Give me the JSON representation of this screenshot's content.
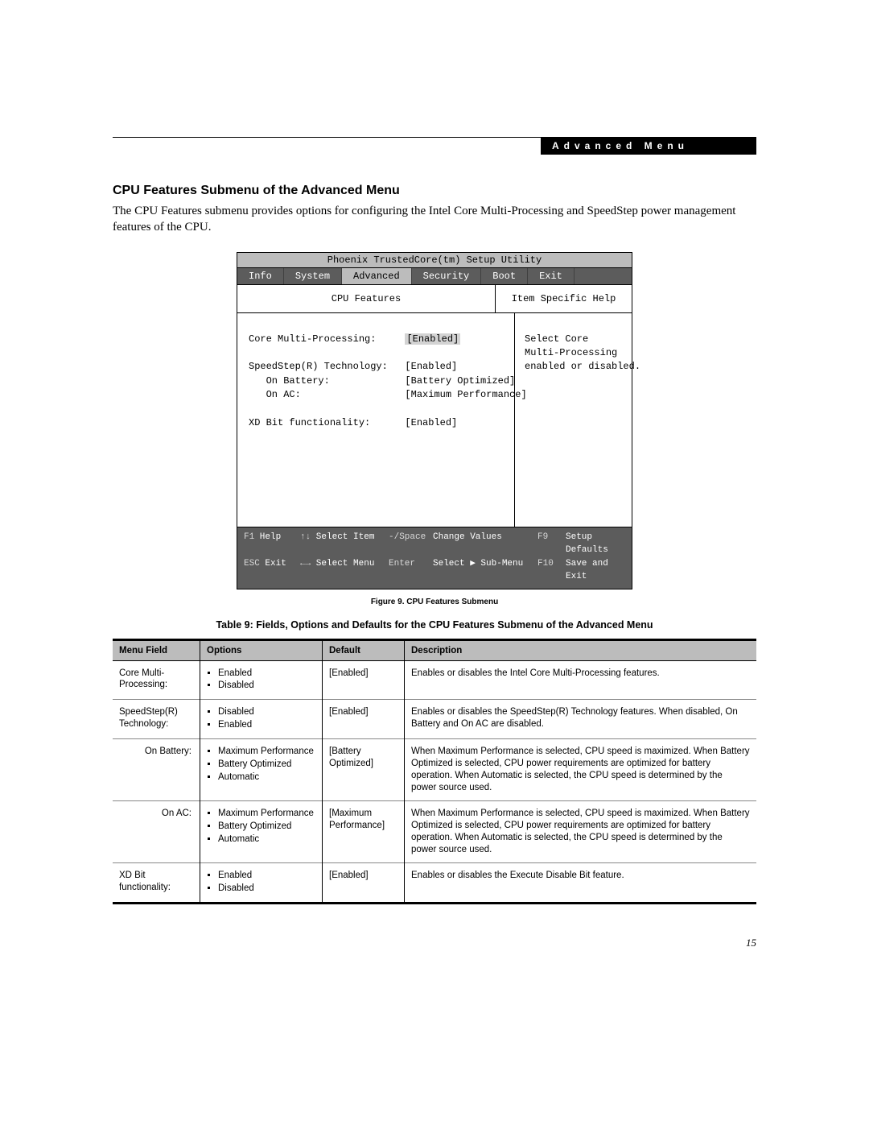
{
  "header": {
    "menuLabel": "Advanced Menu"
  },
  "section": {
    "title": "CPU Features Submenu of the Advanced Menu",
    "intro": "The CPU Features submenu provides options for configuring the Intel Core Multi-Processing and SpeedStep power management features of the CPU."
  },
  "bios": {
    "utilityTitle": "Phoenix TrustedCore(tm) Setup Utility",
    "tabs": [
      "Info",
      "System",
      "Advanced",
      "Security",
      "Boot",
      "Exit"
    ],
    "activeTab": "Advanced",
    "leftTitle": "CPU Features",
    "rightTitle": "Item Specific Help",
    "fields": [
      {
        "label": "Core Multi-Processing:",
        "value": "[Enabled]",
        "indent": 0,
        "selected": true
      },
      {
        "label": "",
        "value": "",
        "indent": 0
      },
      {
        "label": "SpeedStep(R) Technology:",
        "value": "[Enabled]",
        "indent": 0
      },
      {
        "label": "On Battery:",
        "value": "[Battery Optimized]",
        "indent": 1
      },
      {
        "label": "On AC:",
        "value": "[Maximum Performance]",
        "indent": 1
      },
      {
        "label": "",
        "value": "",
        "indent": 0
      },
      {
        "label": "XD Bit functionality:",
        "value": "[Enabled]",
        "indent": 0
      }
    ],
    "help": "Select Core\nMulti-Processing\nenabled or disabled.",
    "footer": [
      {
        "k1": "F1",
        "a1": "Help",
        "k2": "↑↓",
        "a2": "Select Item",
        "k3": "-/Space",
        "a3": "Change Values",
        "k4": "F9",
        "a4": "Setup Defaults"
      },
      {
        "k1": "ESC",
        "a1": "Exit",
        "k2": "←→",
        "a2": "Select Menu",
        "k3": "Enter",
        "a3": "Select ▶ Sub-Menu",
        "k4": "F10",
        "a4": "Save and Exit"
      }
    ]
  },
  "figureCaption": "Figure 9.  CPU Features Submenu",
  "tableTitle": "Table 9: Fields, Options and Defaults for the CPU Features Submenu of the Advanced Menu",
  "table": {
    "headers": [
      "Menu Field",
      "Options",
      "Default",
      "Description"
    ],
    "rows": [
      {
        "menu": "Core Multi-Processing:",
        "indent": false,
        "options": [
          "Enabled",
          "Disabled"
        ],
        "default": "[Enabled]",
        "desc": "Enables or disables the Intel Core Multi-Processing features."
      },
      {
        "menu": "SpeedStep(R) Technology:",
        "indent": false,
        "options": [
          "Disabled",
          "Enabled"
        ],
        "default": "[Enabled]",
        "desc": "Enables or disables the SpeedStep(R) Technology features. When disabled, On Battery and On AC are disabled."
      },
      {
        "menu": "On Battery:",
        "indent": true,
        "options": [
          "Maximum Performance",
          "Battery Optimized",
          "Automatic"
        ],
        "default": "[Battery Optimized]",
        "desc": "When Maximum Performance is selected, CPU speed is maximized. When Battery Optimized is selected, CPU power requirements are optimized for battery operation. When Automatic is selected, the CPU speed is determined by the power source used."
      },
      {
        "menu": "On AC:",
        "indent": true,
        "options": [
          "Maximum Performance",
          "Battery Optimized",
          "Automatic"
        ],
        "default": "[Maximum Performance]",
        "desc": "When Maximum Performance is selected, CPU speed is maximized. When Battery Optimized is selected, CPU power requirements are optimized for battery operation. When Automatic is selected, the CPU speed is determined by the power source used."
      },
      {
        "menu": "XD Bit functionality:",
        "indent": false,
        "options": [
          "Enabled",
          "Disabled"
        ],
        "default": "[Enabled]",
        "desc": "Enables or disables the Execute Disable Bit feature."
      }
    ]
  },
  "pageNumber": "15"
}
